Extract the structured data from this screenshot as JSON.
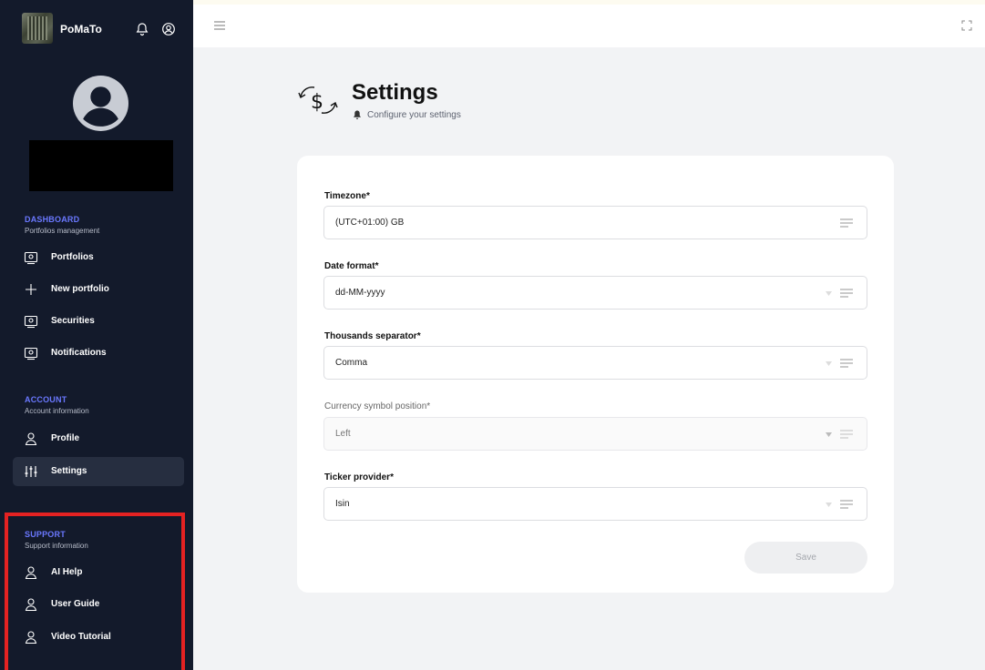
{
  "app": {
    "name": "PoMaTo"
  },
  "sidebar": {
    "sections": [
      {
        "title": "DASHBOARD",
        "subtitle": "Portfolios management",
        "items": [
          {
            "label": "Portfolios",
            "icon": "monitor-icon"
          },
          {
            "label": "New portfolio",
            "icon": "plus-icon"
          },
          {
            "label": "Securities",
            "icon": "monitor-icon"
          },
          {
            "label": "Notifications",
            "icon": "monitor-icon"
          }
        ]
      },
      {
        "title": "ACCOUNT",
        "subtitle": "Account information",
        "items": [
          {
            "label": "Profile",
            "icon": "user-icon"
          },
          {
            "label": "Settings",
            "icon": "sliders-icon",
            "active": true
          }
        ]
      },
      {
        "title": "SUPPORT",
        "subtitle": "Support information",
        "items": [
          {
            "label": "AI Help",
            "icon": "user-icon"
          },
          {
            "label": "User Guide",
            "icon": "user-icon"
          },
          {
            "label": "Video Tutorial",
            "icon": "user-icon"
          }
        ]
      }
    ]
  },
  "header": {
    "title": "Settings",
    "subtitle": "Configure your settings"
  },
  "form": {
    "fields": [
      {
        "label": "Timezone*",
        "value": "(UTC+01:00) GB",
        "disabled": false
      },
      {
        "label": "Date format*",
        "value": "dd-MM-yyyy",
        "disabled": false
      },
      {
        "label": "Thousands separator*",
        "value": "Comma",
        "disabled": false
      },
      {
        "label": "Currency symbol position*",
        "value": "Left",
        "disabled": true
      },
      {
        "label": "Ticker provider*",
        "value": "Isin",
        "disabled": false
      }
    ],
    "save_label": "Save"
  },
  "colors": {
    "sidebar_bg": "#131a2b",
    "section_title": "#6a78ff",
    "highlight": "#e52222"
  }
}
